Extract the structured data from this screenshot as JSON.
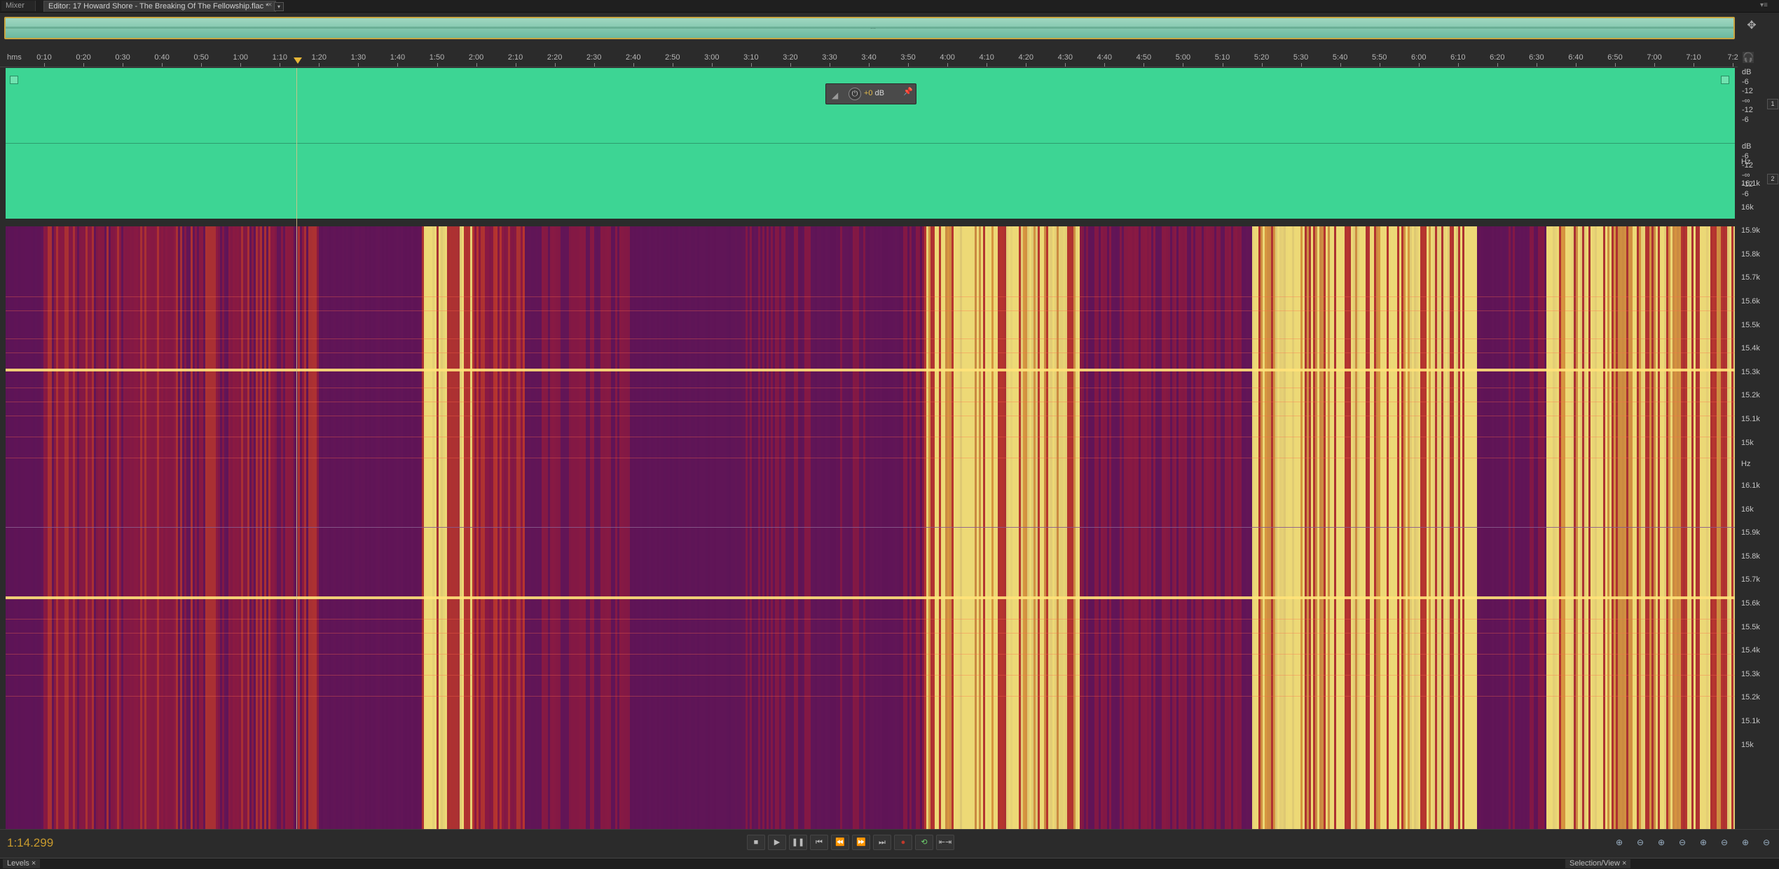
{
  "tabs": {
    "mixer": "Mixer",
    "editor": "Editor: 17 Howard Shore - The Breaking Of The Fellowship.flac *",
    "close": "×",
    "dropdown": "▾"
  },
  "ruler": {
    "unit": "hms",
    "ticks": [
      "0:10",
      "0:20",
      "0:30",
      "0:40",
      "0:50",
      "1:00",
      "1:10",
      "1:20",
      "1:30",
      "1:40",
      "1:50",
      "2:00",
      "2:10",
      "2:20",
      "2:30",
      "2:40",
      "2:50",
      "3:00",
      "3:10",
      "3:20",
      "3:30",
      "3:40",
      "3:50",
      "4:00",
      "4:10",
      "4:20",
      "4:30",
      "4:40",
      "4:50",
      "5:00",
      "5:10",
      "5:20",
      "5:30",
      "5:40",
      "5:50",
      "6:00",
      "6:10",
      "6:20",
      "6:30",
      "6:40",
      "6:50",
      "7:00",
      "7:10",
      "7:2"
    ]
  },
  "hud": {
    "sign": "+0",
    "unit": "dB"
  },
  "amplitude_scale": {
    "channel1": [
      "dB",
      "-6",
      "-12",
      "-∞",
      "-12",
      "-6"
    ],
    "channel2": [
      "dB",
      "-6",
      "-12",
      "-∞",
      "-12",
      "-6"
    ],
    "channel_labels": [
      "1",
      "2"
    ]
  },
  "frequency_scale": {
    "unit": "Hz",
    "labels": [
      "16.1k",
      "16k",
      "15.9k",
      "15.8k",
      "15.7k",
      "15.6k",
      "15.5k",
      "15.4k",
      "15.3k",
      "15.2k",
      "15.1k",
      "15k"
    ]
  },
  "transport": {
    "current_time": "1:14.299",
    "buttons": [
      "■",
      "▶",
      "❚❚",
      "⏮",
      "⏪",
      "⏩",
      "⏭",
      "●",
      "⟲",
      "⇤⇥"
    ]
  },
  "zoom_buttons": [
    "⊕",
    "⊖",
    "⊕",
    "⊖",
    "⊕",
    "⊖",
    "⊕",
    "⊖"
  ],
  "panels": {
    "levels": "Levels",
    "selection_view": "Selection/View"
  },
  "colors": {
    "waveform": "#3dd594",
    "spectral_low": "#4c1256",
    "spectral_mid": "#c62b1e",
    "spectral_high": "#fff27a",
    "time_display": "#c89a2d"
  },
  "playhead_time": "1:14.299"
}
